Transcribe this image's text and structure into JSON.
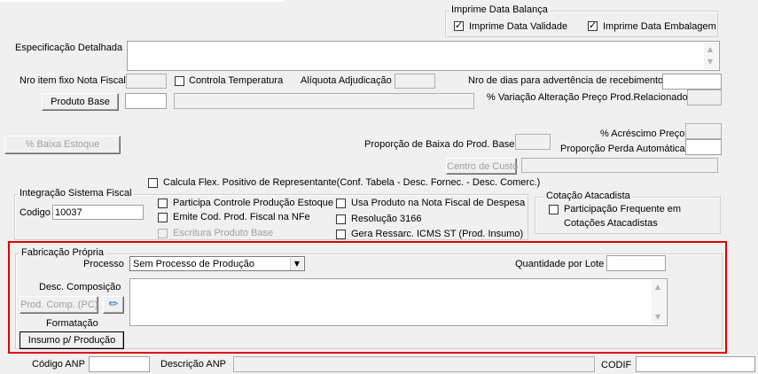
{
  "imprime_group": {
    "title": "Imprime Data Balança",
    "validade_label": "Imprime Data Validade",
    "validade_checked": true,
    "embalagem_label": "Imprime Data Embalagem",
    "embalagem_checked": true
  },
  "especificacao_label": "Especificação Detalhada",
  "nro_item_label": "Nro item fixo Nota Fiscal",
  "controla_temp_label": "Controla Temperatura",
  "aliquota_label": "Alíquota Adjudicação",
  "nro_dias_label": "Nro de dias para advertência de recebimento",
  "produto_base_button": "Produto Base",
  "variacao_label": "% Variação Alteração Preço Prod.Relacionado",
  "baixa_estoque_button": "% Baixa Estoque",
  "acrescimo_label": "% Acréscimo Preço",
  "proporcao_baixa_label": "Proporção de Baixa do Prod. Base",
  "proporcao_perda_label": "Proporção Perda Automática",
  "centro_custo_button": "Centro de Custo",
  "calcula_flex_label": "Calcula Flex. Positivo de Representante(Conf. Tabela - Desc. Fornec. - Desc. Comerc.)",
  "integracao": {
    "title": "Integração Sistema Fiscal",
    "codigo_label": "Codigo",
    "codigo_value": "10037",
    "participa_label": "Participa Controle Produção Estoque",
    "emite_label": "Emite Cod. Prod. Fiscal na NFe",
    "escritura_label": "Escritura Produto Base",
    "usa_produto_label": "Usa Produto na Nota Fiscal de Despesa",
    "resolucao_label": "Resolução 3166",
    "gera_ressarc_label": "Gera Ressarc. ICMS ST (Prod. Insumo)"
  },
  "cotacao": {
    "title": "Cotação Atacadista",
    "line1": "Participação Frequente em",
    "line2": "Cotações Atacadistas"
  },
  "fabricacao": {
    "title": "Fabricação Própria",
    "processo_label": "Processo",
    "processo_value": "Sem Processo de Produção",
    "quantidade_label": "Quantidade por Lote",
    "desc_composicao_label": "Desc. Composição",
    "prod_comp_button": "Prod. Comp. (PC)",
    "formatacao_label": "Formatação",
    "insumo_button": "Insumo p/ Produção",
    "highlight_color": "#e00000"
  },
  "codigo_anp_label": "Código ANP",
  "descricao_anp_label": "Descrição ANP",
  "codif_label": "CODIF"
}
